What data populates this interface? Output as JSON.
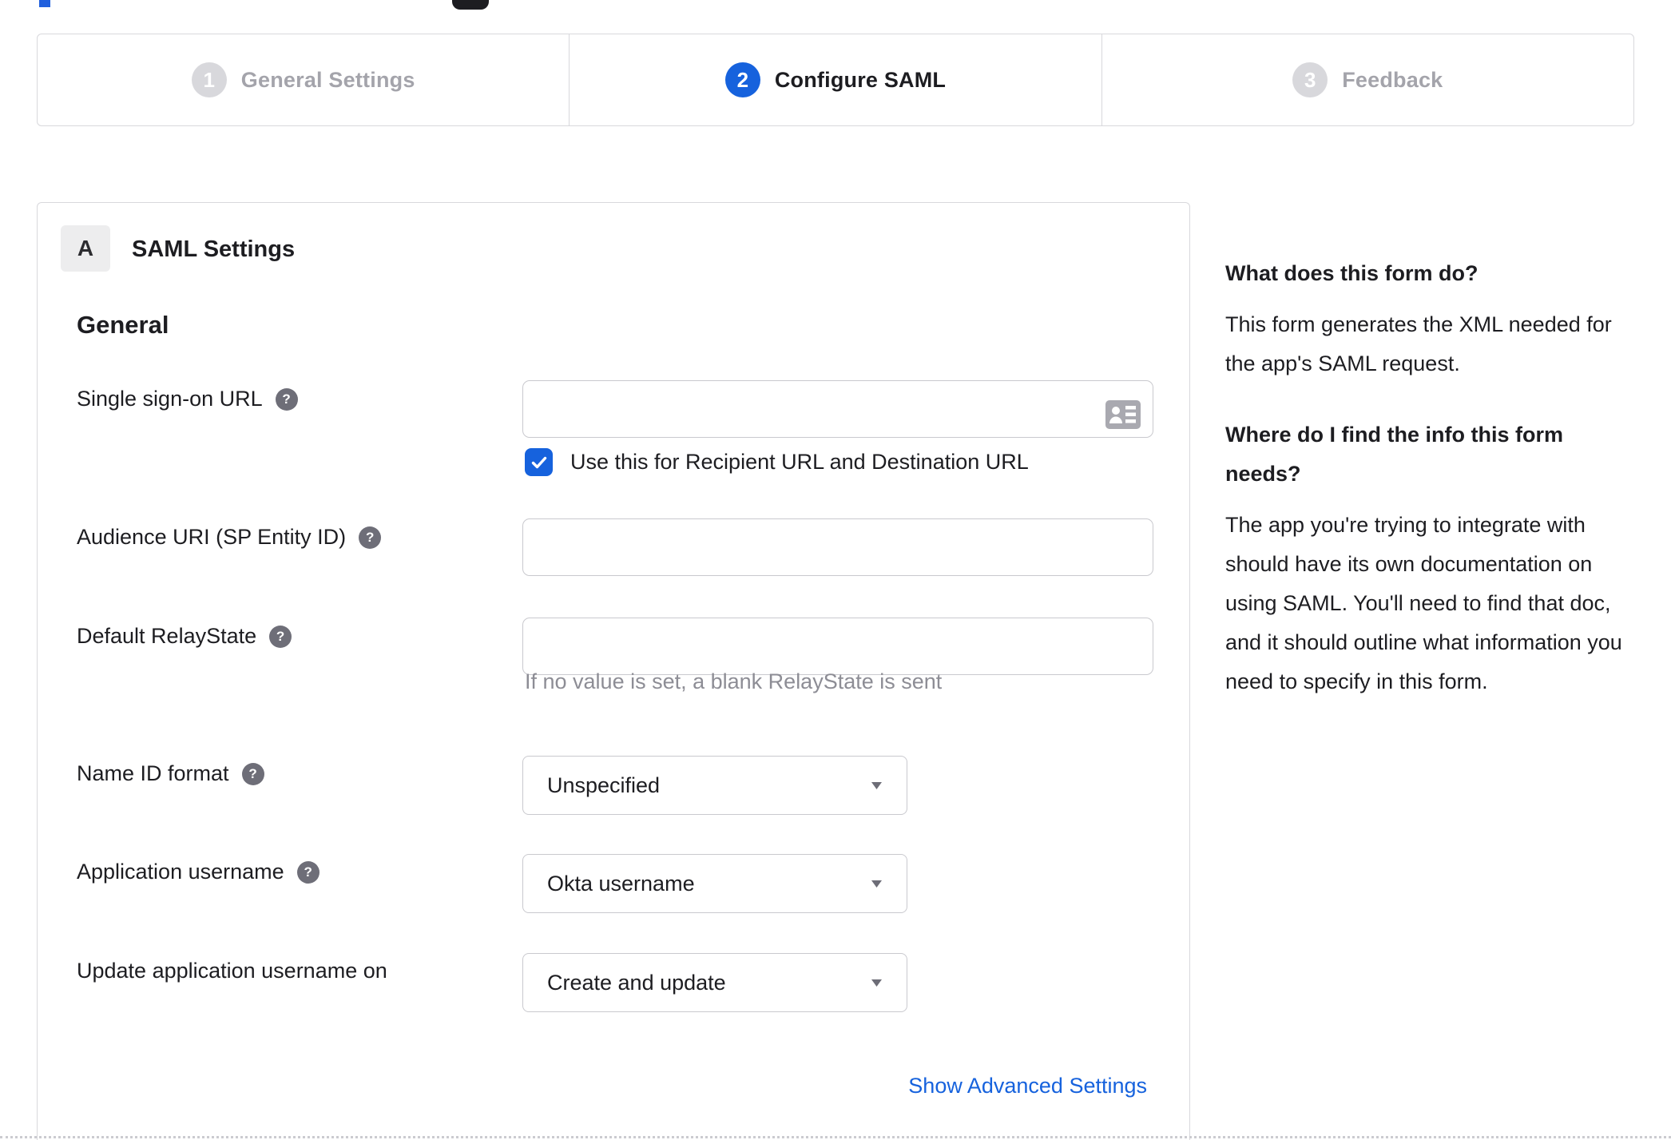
{
  "stepper": {
    "steps": [
      {
        "number": "1",
        "label": "General Settings",
        "state": "inactive"
      },
      {
        "number": "2",
        "label": "Configure SAML",
        "state": "active"
      },
      {
        "number": "3",
        "label": "Feedback",
        "state": "inactive"
      }
    ]
  },
  "panel": {
    "section_badge": "A",
    "section_title": "SAML Settings",
    "group_heading": "General",
    "fields": {
      "sso_url": {
        "label": "Single sign-on URL",
        "value": "",
        "has_help_icon": true,
        "checkbox_label": "Use this for Recipient URL and Destination URL",
        "checkbox_checked": true
      },
      "audience_uri": {
        "label": "Audience URI (SP Entity ID)",
        "value": "",
        "has_help_icon": true
      },
      "relay_state": {
        "label": "Default RelayState",
        "value": "",
        "has_help_icon": true,
        "helper": "If no value is set, a blank RelayState is sent"
      },
      "name_id_format": {
        "label": "Name ID format",
        "selected_value": "Unspecified",
        "has_help_icon": true
      },
      "application_username": {
        "label": "Application username",
        "selected_value": "Okta username",
        "has_help_icon": true
      },
      "update_application_username_on": {
        "label": "Update application username on",
        "selected_value": "Create and update",
        "has_help_icon": false
      }
    },
    "advanced_link": "Show Advanced Settings"
  },
  "sidebar": {
    "sections": [
      {
        "heading": "What does this form do?",
        "body": "This form generates the XML needed for the app's SAML request."
      },
      {
        "heading": "Where do I find the info this form needs?",
        "body": "The app you're trying to integrate with should have its own documentation on using SAML. You'll need to find that doc, and it should outline what information you need to specify in this form."
      }
    ]
  },
  "icons": {
    "help": "question-mark-circle",
    "sso_input_right": "contact-card",
    "dropdown": "chevron-down",
    "checkbox": "checkmark"
  },
  "colors": {
    "accent_blue": "#1662dd",
    "inactive_step_gray": "#d8d8dc",
    "inactive_label_gray": "#a4a4ab",
    "border_gray": "#d8d8dc",
    "input_border_gray": "#c9c9ce",
    "helper_text_gray": "#8d8d95",
    "help_icon_gray": "#6e6e78",
    "text_dark": "#1d1d21"
  }
}
